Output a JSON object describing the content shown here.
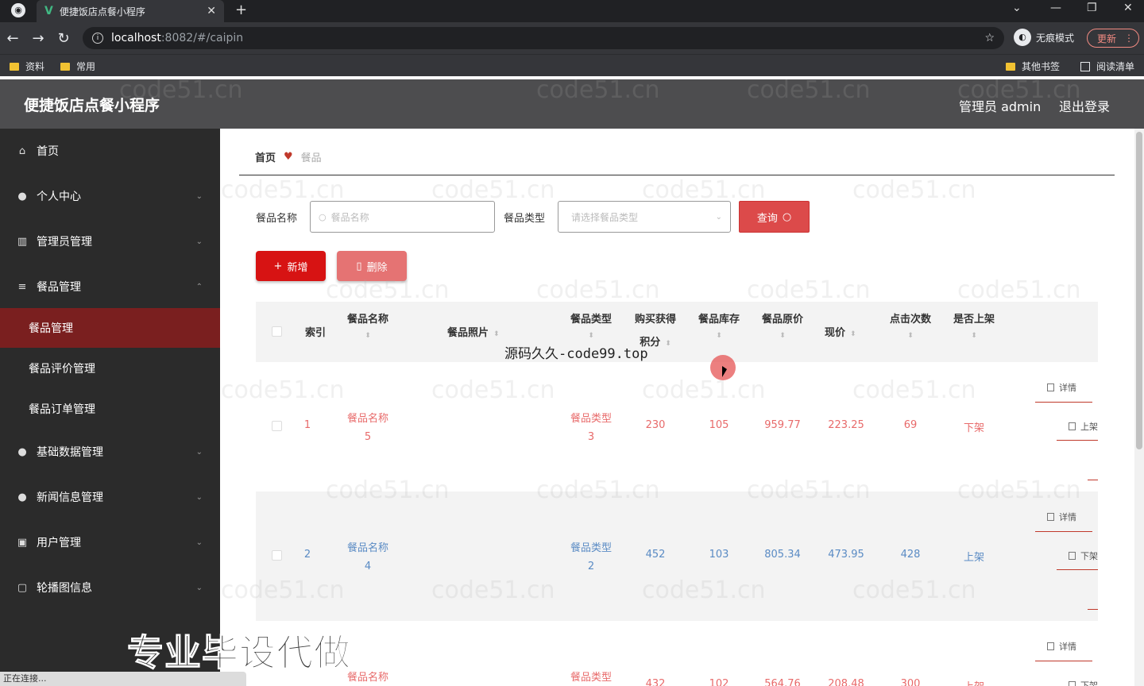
{
  "browser": {
    "tab_title": "便捷饭店点餐小程序",
    "url_host": "localhost",
    "url_path": ":8082/#/caipin",
    "incognito_label": "无痕模式",
    "update_label": "更新",
    "bookmarks": [
      "资料",
      "常用"
    ],
    "other_bookmarks": "其他书签",
    "reading_list": "阅读清单",
    "status": "正在连接..."
  },
  "header": {
    "title": "便捷饭店点餐小程序",
    "user": "管理员 admin",
    "logout": "退出登录"
  },
  "sidebar": {
    "items": [
      {
        "label": "首页",
        "icon": "home-icon"
      },
      {
        "label": "个人中心",
        "icon": "user-icon"
      },
      {
        "label": "管理员管理",
        "icon": "chart-icon"
      },
      {
        "label": "餐品管理",
        "icon": "menu-icon"
      },
      {
        "label": "基础数据管理",
        "icon": "user-icon"
      },
      {
        "label": "新闻信息管理",
        "icon": "pin-icon"
      },
      {
        "label": "用户管理",
        "icon": "box-icon"
      },
      {
        "label": "轮播图信息",
        "icon": "square-icon"
      }
    ],
    "submenu": [
      "餐品管理",
      "餐品评价管理",
      "餐品订单管理"
    ]
  },
  "breadcrumb": {
    "home": "首页",
    "current": "餐品"
  },
  "filters": {
    "name_label": "餐品名称",
    "name_placeholder": "餐品名称",
    "type_label": "餐品类型",
    "type_placeholder": "请选择餐品类型",
    "query_label": "查询"
  },
  "actions": {
    "add": "新增",
    "delete": "删除"
  },
  "table": {
    "headers": {
      "index": "索引",
      "name": "餐品名称",
      "photo": "餐品照片",
      "type": "餐品类型",
      "points_line1": "购买获得",
      "points_line2": "积分",
      "stock": "餐品库存",
      "orig_price": "餐品原价",
      "price": "现价",
      "clicks": "点击次数",
      "on_shelf": "是否上架"
    },
    "rows": [
      {
        "index": "1",
        "name1": "餐品名称",
        "name2": "5",
        "type1": "餐品类型",
        "type2": "3",
        "points": "230",
        "stock": "105",
        "orig": "959.77",
        "price": "223.25",
        "clicks": "69",
        "shelf": "下架",
        "op_detail": "详情",
        "op_shelf": "上架"
      },
      {
        "index": "2",
        "name1": "餐品名称",
        "name2": "4",
        "type1": "餐品类型",
        "type2": "2",
        "points": "452",
        "stock": "103",
        "orig": "805.34",
        "price": "473.95",
        "clicks": "428",
        "shelf": "上架",
        "op_detail": "详情",
        "op_shelf": "下架"
      },
      {
        "index": "",
        "name1": "餐品名称",
        "name2": "",
        "type1": "餐品类型",
        "type2": "",
        "points": "432",
        "stock": "102",
        "orig": "564.76",
        "price": "208.48",
        "clicks": "300",
        "shelf": "上架",
        "op_detail": "详情",
        "op_shelf": "下架"
      }
    ]
  },
  "overlays": {
    "watermark": "code51.cn",
    "source_text": "源码久久-code99.top",
    "promo_text": "专业毕设代做"
  },
  "colors": {
    "accent": "#d71313",
    "sidebar_bg": "#2b2b2b",
    "active_menu": "#7a1f1f"
  }
}
